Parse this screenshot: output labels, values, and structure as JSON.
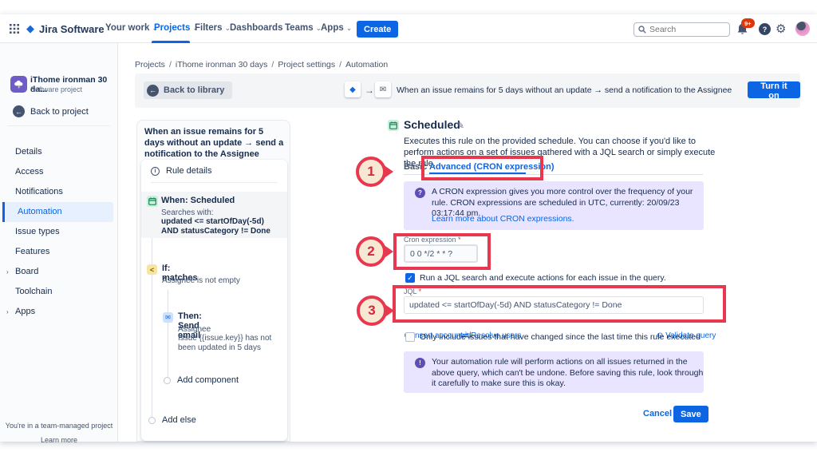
{
  "icons": {
    "chevron_down": "⌄",
    "chevron_right": "›",
    "diamond": "◆",
    "arrow_right": "→",
    "arrow_left": "←",
    "envelope": "✉",
    "pencil": "✎",
    "gear": "⚙",
    "question": "?",
    "exclamation": "!",
    "info_letter": "i",
    "check": "✓",
    "branch": "<",
    "insert_glyph": "⊕",
    "resolve_glyph": "⇄",
    "validate_glyph": "⊙"
  },
  "colors": {
    "accent_blue": "#0C66E4",
    "annotation_red": "#E8384F",
    "info_purple_bg": "#E9E4FF",
    "selected_item_bg": "#E7F0FE"
  },
  "nav": {
    "brand": "Jira Software",
    "items": [
      "Your work",
      "Projects",
      "Filters",
      "Dashboards",
      "Teams",
      "Apps"
    ],
    "create": "Create",
    "search_placeholder": "Search",
    "notif_badge": "9+"
  },
  "sidebar": {
    "project_name": "iThome ironman 30 da...",
    "project_type": "Software project",
    "back": "Back to project",
    "items": [
      "Details",
      "Access",
      "Notifications",
      "Automation",
      "Issue types",
      "Features",
      "Board",
      "Toolchain",
      "Apps"
    ],
    "footer_note": "You're in a team-managed project",
    "footer_link": "Learn more"
  },
  "breadcrumb": {
    "separator": "/",
    "items": [
      "Projects",
      "iThome ironman 30 days",
      "Project settings",
      "Automation"
    ]
  },
  "ruleheader": {
    "back": "Back to library",
    "summary": "When an issue remains for 5 days without an update → send a notification to the Assignee",
    "turn_on": "Turn it on"
  },
  "rulepanel": {
    "title": "When an issue remains for 5 days without an update → send a notification to the Assignee",
    "rule_details": "Rule details",
    "when_title": "When: Scheduled",
    "searches_with": "Searches with:",
    "query": "updated <= startOfDay(-5d) AND statusCategory != Done",
    "if_title": "If: matches",
    "if_desc": "Assignee is not empty",
    "then_title": "Then: Send email",
    "then_to": "Assignee",
    "then_body": "Issue {{issue.key}} has not been updated in 5 days",
    "add_component": "Add component",
    "add_else": "Add else"
  },
  "editor": {
    "title": "Scheduled",
    "description": "Executes this rule on the provided schedule. You can choose if you'd like to perform actions on a set of issues gathered with a JQL search or simply execute the rule.",
    "tabs": {
      "basic": "Basic",
      "advanced": "Advanced (CRON expression)"
    },
    "info_text": "A CRON expression gives you more control over the frequency of your rule. CRON expressions are scheduled in UTC, currently: 20/09/23 03:17:44 pm.",
    "info_link": "Learn more about CRON expressions.",
    "cron_label": "Cron expression",
    "cron_value": "0 0 */2 * * ?",
    "run_jql_label": "Run a JQL search and execute actions for each issue in the query.",
    "jql_label": "JQL",
    "jql_value": "updated <= startOfDay(-5d) AND statusCategory != Done",
    "links": {
      "insert": "Insert account id",
      "resolve": "Resolve users",
      "validate": "Validate query"
    },
    "only_changed_label": "Only include issues that have changed since the last time this rule executed",
    "warning_text": "Your automation rule will perform actions on all issues returned in the above query, which can't be undone. Before saving this rule, look through it carefully to make sure this is okay.",
    "cancel": "Cancel",
    "save": "Save"
  },
  "annotations": {
    "one": "1",
    "two": "2",
    "three": "3"
  }
}
